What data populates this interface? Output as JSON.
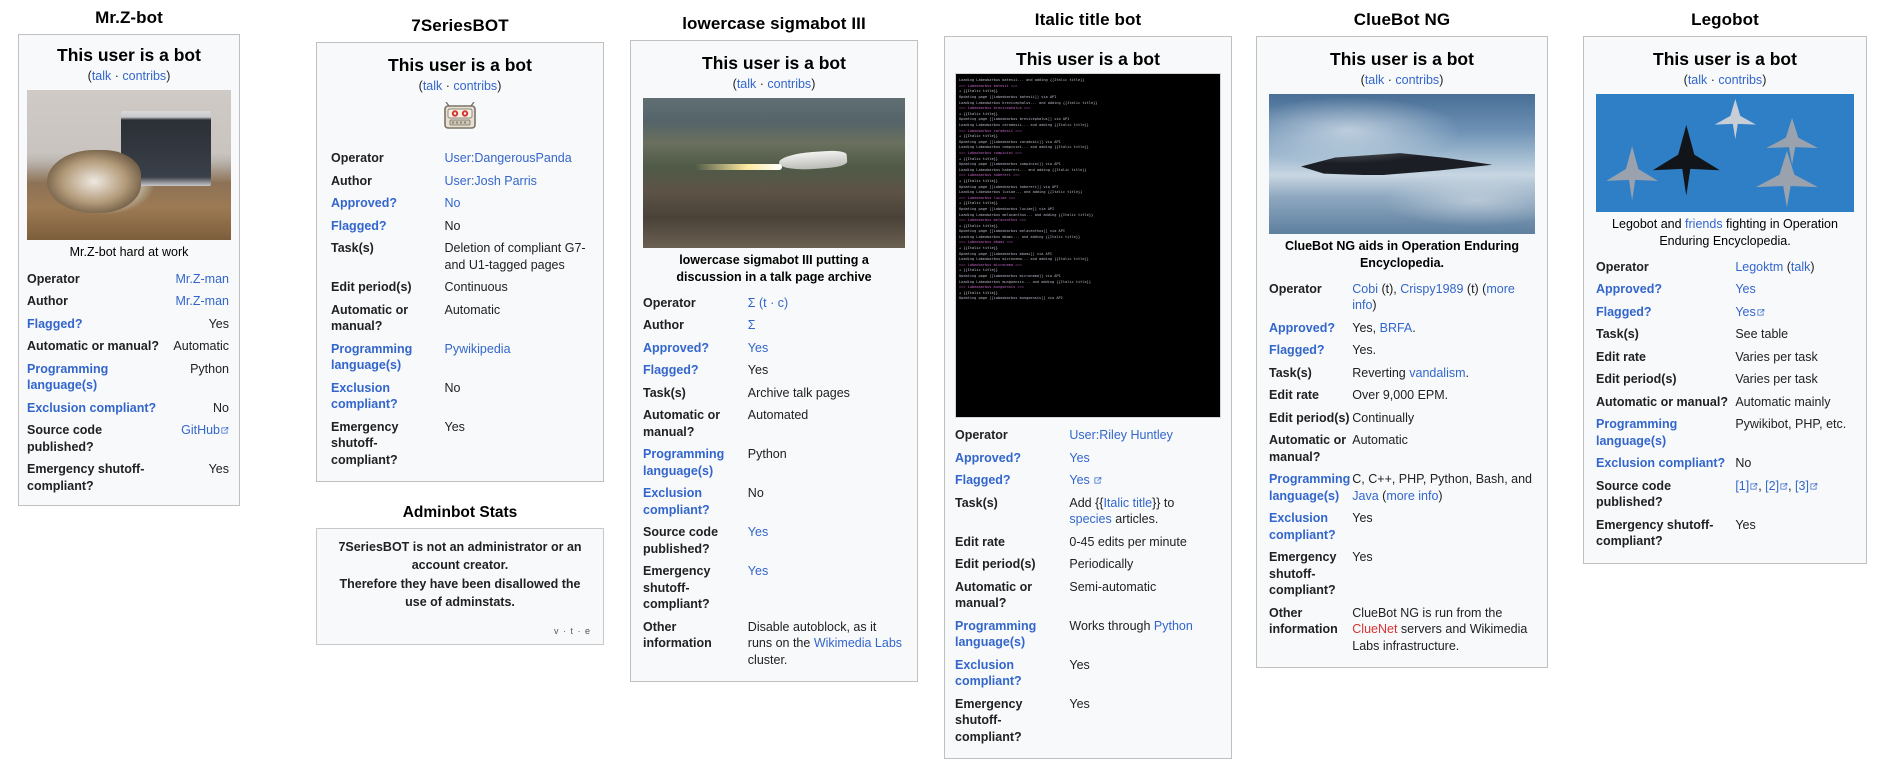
{
  "page": {
    "background": "#ffffff",
    "link_color": "#3366cc",
    "red_link_color": "#d73333",
    "box_bg": "#f8f9fa",
    "box_border": "#c0c0c0"
  },
  "common": {
    "bot_heading": "This user is a bot",
    "talk_label": "talk",
    "contribs_label": "contribs",
    "separator": "·",
    "open_paren": "(",
    "close_paren": ")"
  },
  "cards": [
    {
      "id": "mrzbot",
      "column_title": "Mr.Z-bot",
      "heading": "This user is a bot",
      "image_name": "cat-at-computer-photo",
      "caption": "Mr.Z-bot hard at work",
      "caption_bold": false,
      "rows": [
        {
          "label": "Operator",
          "label_link": false,
          "value": "Mr.Z-man",
          "value_link": true
        },
        {
          "label": "Author",
          "label_link": false,
          "value": "Mr.Z-man",
          "value_link": true
        },
        {
          "label": "Flagged?",
          "label_link": true,
          "value": "Yes",
          "value_link": false
        },
        {
          "label": "Automatic or manual?",
          "label_link": false,
          "value": "Automatic",
          "value_link": false
        },
        {
          "label": "Programming language(s)",
          "label_link": true,
          "value": "Python",
          "value_link": false
        },
        {
          "label": "Exclusion compliant?",
          "label_link": true,
          "value": "No",
          "value_link": false
        },
        {
          "label": "Source code published?",
          "label_link": false,
          "value": "GitHub",
          "value_link": true,
          "external": true
        },
        {
          "label": "Emergency shutoff-compliant?",
          "label_link": false,
          "value": "Yes",
          "value_link": false
        }
      ]
    },
    {
      "id": "7seriesbot",
      "column_title": "7SeriesBOT",
      "heading": "This user is a bot",
      "image_name": "robot-face-icon",
      "caption": "",
      "rows": [
        {
          "label": "Operator",
          "label_link": false,
          "value": "User:DangerousPanda",
          "value_link": true
        },
        {
          "label": "Author",
          "label_link": false,
          "value": "User:Josh Parris",
          "value_link": true
        },
        {
          "label": "Approved?",
          "label_link": true,
          "value": "No",
          "value_link": true
        },
        {
          "label": "Flagged?",
          "label_link": true,
          "value": "No",
          "value_link": false
        },
        {
          "label": "Task(s)",
          "label_link": false,
          "value": "Deletion of compliant G7- and U1-tagged pages",
          "value_link": false
        },
        {
          "label": "Edit period(s)",
          "label_link": false,
          "value": "Continuous",
          "value_link": false
        },
        {
          "label": "Automatic or manual?",
          "label_link": false,
          "value": "Automatic",
          "value_link": false
        },
        {
          "label": "Programming language(s)",
          "label_link": true,
          "value": "Pywikipedia",
          "value_link": true
        },
        {
          "label": "Exclusion compliant?",
          "label_link": true,
          "value": "No",
          "value_link": false
        },
        {
          "label": "Emergency shutoff-compliant?",
          "label_link": false,
          "value": "Yes",
          "value_link": false
        }
      ],
      "substack": {
        "title": "Adminbot Stats",
        "lines": [
          "7SeriesBOT is not an administrator or an account creator.",
          "Therefore they have been disallowed the use of adminstats."
        ],
        "vte": "v · t · e"
      }
    },
    {
      "id": "sigmabot3",
      "column_title": "lowercase sigmabot III",
      "heading": "This user is a bot",
      "image_name": "jet-firing-missile-photo",
      "caption": "lowercase sigmabot III putting a discussion in a talk page archive",
      "caption_bold": true,
      "rows": [
        {
          "label": "Operator",
          "label_link": false,
          "value": "Σ (t · c)",
          "value_link": true
        },
        {
          "label": "Author",
          "label_link": false,
          "value": "Σ",
          "value_link": true
        },
        {
          "label": "Approved?",
          "label_link": true,
          "value": "Yes",
          "value_link": true
        },
        {
          "label": "Flagged?",
          "label_link": true,
          "value": "Yes",
          "value_link": false
        },
        {
          "label": "Task(s)",
          "label_link": false,
          "value": "Archive talk pages",
          "value_link": false
        },
        {
          "label": "Automatic or manual?",
          "label_link": false,
          "value": "Automated",
          "value_link": false
        },
        {
          "label": "Programming language(s)",
          "label_link": true,
          "value": "Python",
          "value_link": false
        },
        {
          "label": "Exclusion compliant?",
          "label_link": true,
          "value": "No",
          "value_link": false
        },
        {
          "label": "Source code published?",
          "label_link": false,
          "value": "Yes",
          "value_link": true
        },
        {
          "label": "Emergency shutoff-compliant?",
          "label_link": false,
          "value": "Yes",
          "value_link": true
        },
        {
          "label": "Other information",
          "label_link": false,
          "value": "Disable autoblock, as it runs on the Wikimedia Labs cluster.",
          "value_link": false,
          "value_html": "other_info"
        }
      ],
      "other_info": {
        "prefix": "Disable autoblock, as it runs on the ",
        "link": "Wikimedia Labs",
        "suffix": " cluster."
      }
    },
    {
      "id": "italictitlebot",
      "column_title": "Italic title bot",
      "heading": "This user is a bot",
      "image_name": "terminal-console-screenshot",
      "caption": "",
      "terminal_lines": [
        "Loading Labeobarbus batesii... and adding {{Italic title}}",
        "=== Labeobarbus batesii ===",
        "+ {{Italic title}}",
        "Updating page [[Labeobarbus batesii]] via API",
        "Loading Labeobarbus brevicephalus... and adding {{Italic title}}",
        "=== Labeobarbus brevicephalus ===",
        "+ {{Italic title}}",
        "Updating page [[Labeobarbus brevicephalus]] via API",
        "Loading Labeobarbus caradosii... and adding {{Italic title}}",
        "=== Labeobarbus caradosii ===",
        "+ {{Italic title}}",
        "Updating page [[Labeobarbus caradosii]] via API",
        "Loading Labeobarbus compiniei... and adding {{Italic title}}",
        "=== Labeobarbus compiniei ===",
        "+ {{Italic title}}",
        "Updating page [[Labeobarbus compiniei]] via API",
        "Loading Labeobarbus habereri... and adding {{Italic title}}",
        "=== Labeobarbus habereri ===",
        "+ {{Italic title}}",
        "Updating page [[Labeobarbus habereri]] via API",
        "Loading Labeobarbus luciae... and adding {{Italic title}}",
        "=== Labeobarbus luciae ===",
        "+ {{Italic title}}",
        "Updating page [[Labeobarbus luciae]] via API",
        "Loading Labeobarbus melacanthus... and adding {{Italic title}}",
        "=== Labeobarbus melacanthus ===",
        "+ {{Italic title}}",
        "Updating page [[Labeobarbus melacanthus]] via API",
        "Loading Labeobarbus mbami... and adding {{Italic title}}",
        "=== Labeobarbus mbami ===",
        "+ {{Italic title}}",
        "Updating page [[Labeobarbus mbami]] via API",
        "Loading Labeobarbus micronema... and adding {{Italic title}}",
        "=== Labeobarbus micronema ===",
        "+ {{Italic title}}",
        "Updating page [[Labeobarbus micronema]] via API",
        "Loading Labeobarbus mungoensis... and adding {{Italic title}}",
        "=== Labeobarbus mungoensis ===",
        "+ {{Italic title}}",
        "Updating page [[Labeobarbus mungoensis]] via API"
      ],
      "rows": [
        {
          "label": "Operator",
          "label_link": false,
          "value": "User:Riley Huntley",
          "value_link": true
        },
        {
          "label": "Approved?",
          "label_link": true,
          "value": "Yes",
          "value_link": true
        },
        {
          "label": "Flagged?",
          "label_link": true,
          "value": "Yes",
          "value_link": true,
          "external": true
        },
        {
          "label": "Task(s)",
          "label_link": false,
          "value": "Add {{Italic title}} to species articles.",
          "value_link": false,
          "value_html": "task_info"
        },
        {
          "label": "Edit rate",
          "label_link": false,
          "value": "0-45 edits per minute",
          "value_link": false
        },
        {
          "label": "Edit period(s)",
          "label_link": false,
          "value": "Periodically",
          "value_link": false
        },
        {
          "label": "Automatic or manual?",
          "label_link": false,
          "value": "Semi-automatic",
          "value_link": false
        },
        {
          "label": "Programming language(s)",
          "label_link": true,
          "value": "Works through Python",
          "value_link": false,
          "value_html": "lang_info"
        },
        {
          "label": "Exclusion compliant?",
          "label_link": true,
          "value": "Yes",
          "value_link": false
        },
        {
          "label": "Emergency shutoff-compliant?",
          "label_link": false,
          "value": "Yes",
          "value_link": false
        }
      ],
      "task_info": {
        "prefix": "Add {{",
        "link": "Italic title",
        "mid": "}} to ",
        "link2": "species",
        "suffix": " articles."
      },
      "lang_info": {
        "prefix": "Works through ",
        "link": "Python",
        "suffix": ""
      }
    },
    {
      "id": "cluebotng",
      "column_title": "ClueBot NG",
      "heading": "This user is a bot",
      "image_name": "stealth-bomber-photo",
      "caption": "ClueBot NG aids in Operation Enduring Encyclopedia.",
      "caption_bold": true,
      "rows": [
        {
          "label": "Operator",
          "label_link": false,
          "value": "Cobi (t), Crispy1989 (t) (more info)",
          "value_link": true
        },
        {
          "label": "Approved?",
          "label_link": true,
          "value": "Yes, BRFA.",
          "value_link": false,
          "value_html": "approved_info"
        },
        {
          "label": "Flagged?",
          "label_link": true,
          "value": "Yes.",
          "value_link": false
        },
        {
          "label": "Task(s)",
          "label_link": false,
          "value": "Reverting vandalism.",
          "value_link": false,
          "value_html": "task_info"
        },
        {
          "label": "Edit rate",
          "label_link": false,
          "value": "Over 9,000 EPM.",
          "value_link": false
        },
        {
          "label": "Edit period(s)",
          "label_link": false,
          "value": "Continually",
          "value_link": false
        },
        {
          "label": "Automatic or manual?",
          "label_link": false,
          "value": "Automatic",
          "value_link": false
        },
        {
          "label": "Programming language(s)",
          "label_link": true,
          "value": "C, C++, PHP, Python, Bash, and Java (more info)",
          "value_link": false,
          "value_html": "lang_info"
        },
        {
          "label": "Exclusion compliant?",
          "label_link": true,
          "value": "Yes",
          "value_link": false
        },
        {
          "label": "Emergency shutoff-compliant?",
          "label_link": false,
          "value": "Yes",
          "value_link": false
        },
        {
          "label": "Other information",
          "label_link": false,
          "value": "ClueBot NG is run from the ClueNet servers and Wikimedia Labs infrastructure.",
          "value_link": false,
          "value_html": "other_info"
        }
      ],
      "operator_info": {
        "l1": "Cobi",
        "p1": " (t), ",
        "l2": "Crispy1989",
        "p2": " (t) (",
        "l3": "more info",
        "p3": ")"
      },
      "approved_info": {
        "prefix": "Yes, ",
        "link": "BRFA",
        "suffix": "."
      },
      "task_info": {
        "prefix": "Reverting ",
        "link": "vandalism",
        "suffix": "."
      },
      "lang_info": {
        "prefix": "C, C++, PHP, Python, Bash, and ",
        "link": "Java",
        "mid": " (",
        "link2": "more info",
        "suffix": ")"
      },
      "other_info": {
        "prefix": "ClueBot NG is run from the ",
        "link": "ClueNet",
        "suffix": " servers and Wikimedia Labs infrastructure."
      }
    },
    {
      "id": "legobot",
      "column_title": "Legobot",
      "heading": "This user is a bot",
      "image_name": "fighter-jets-blue-photo",
      "caption": "Legobot and friends fighting in Operation Enduring Encyclopedia.",
      "caption_bold": false,
      "caption_info": {
        "prefix": "Legobot and ",
        "link": "friends",
        "suffix": " fighting in Operation Enduring Encyclopedia."
      },
      "rows": [
        {
          "label": "Operator",
          "label_link": false,
          "value": "Legoktm (talk)",
          "value_link": true
        },
        {
          "label": "Approved?",
          "label_link": true,
          "value": "Yes",
          "value_link": true
        },
        {
          "label": "Flagged?",
          "label_link": true,
          "value": "Yes",
          "value_link": true,
          "external": true
        },
        {
          "label": "Task(s)",
          "label_link": false,
          "value": "See table",
          "value_link": false
        },
        {
          "label": "Edit rate",
          "label_link": false,
          "value": "Varies per task",
          "value_link": false
        },
        {
          "label": "Edit period(s)",
          "label_link": false,
          "value": "Varies per task",
          "value_link": false
        },
        {
          "label": "Automatic or manual?",
          "label_link": false,
          "value": "Automatic mainly",
          "value_link": false
        },
        {
          "label": "Programming language(s)",
          "label_link": true,
          "value": "Pywikibot, PHP, etc.",
          "value_link": false
        },
        {
          "label": "Exclusion compliant?",
          "label_link": true,
          "value": "No",
          "value_link": false
        },
        {
          "label": "Source code published?",
          "label_link": false,
          "value": "[1], [2], [3]",
          "value_link": true,
          "value_html": "src_info"
        },
        {
          "label": "Emergency shutoff-compliant?",
          "label_link": false,
          "value": "Yes",
          "value_link": false
        }
      ],
      "operator_info": {
        "l1": "Legoktm",
        "p1": " (",
        "l2": "talk",
        "p2": ")"
      },
      "src_info": {
        "l1": "[1]",
        "p1": ", ",
        "l2": "[2]",
        "p2": ", ",
        "l3": "[3]"
      }
    }
  ]
}
